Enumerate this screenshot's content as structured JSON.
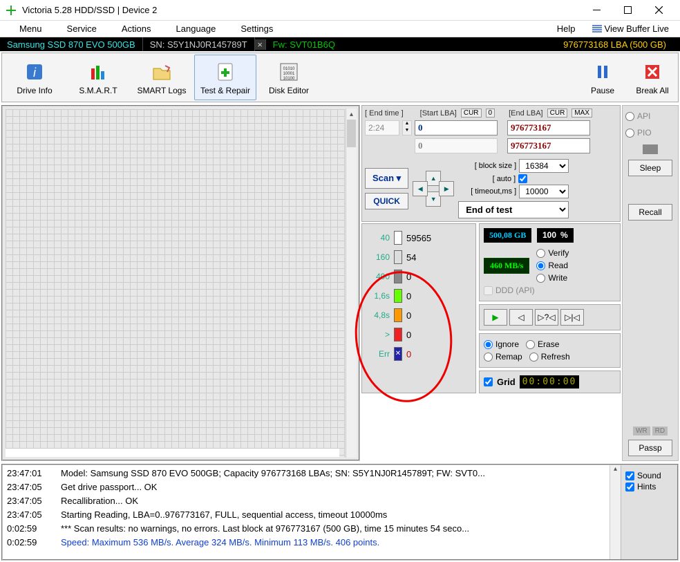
{
  "window": {
    "title": "Victoria 5.28 HDD/SSD | Device 2"
  },
  "menu": {
    "items": [
      "Menu",
      "Service",
      "Actions",
      "Language",
      "Settings"
    ],
    "help": "Help",
    "viewbuffer": "View Buffer Live"
  },
  "infostrip": {
    "drive": "Samsung SSD 870 EVO 500GB",
    "sn": "SN: S5Y1NJ0R145789T",
    "fw": "Fw: SVT01B6Q",
    "lba": "976773168 LBA (500 GB)"
  },
  "toolbar": {
    "driveinfo": "Drive Info",
    "smart": "S.M.A.R.T",
    "smartlogs": "SMART Logs",
    "testrepair": "Test & Repair",
    "diskeditor": "Disk Editor",
    "pause": "Pause",
    "breakall": "Break All"
  },
  "scan": {
    "endtime_lbl": "[ End time ]",
    "startlba_lbl": "[Start LBA]",
    "endlba_lbl": "[End LBA]",
    "cur": "CUR",
    "max": "MAX",
    "zero": "0",
    "endtime_val": "2:24",
    "start_lba": "0",
    "end_lba": "976773167",
    "start_lba_ro": "0",
    "end_lba_ro": "976773167",
    "scan_btn": "Scan ▾",
    "quick_btn": "QUICK",
    "blocksize_lbl": "[ block size ]",
    "auto_lbl": "[ auto ]",
    "timeout_lbl": "[ timeout,ms ]",
    "blocksize": "16384",
    "timeout": "10000",
    "eot": "End of test"
  },
  "stats": [
    {
      "lbl": "40",
      "cls": "b-white",
      "cnt": "59565"
    },
    {
      "lbl": "160",
      "cls": "b-lgray",
      "cnt": "54"
    },
    {
      "lbl": "400",
      "cls": "b-dgray",
      "cnt": "0"
    },
    {
      "lbl": "1,6s",
      "cls": "b-green",
      "cnt": "0"
    },
    {
      "lbl": "4,8s",
      "cls": "b-orange",
      "cnt": "0"
    },
    {
      "lbl": ">",
      "cls": "b-red",
      "cnt": "0"
    },
    {
      "lbl": "Err",
      "cls": "b-blue errx",
      "cnt": "0",
      "err": true
    }
  ],
  "status": {
    "size": "500,08 GB",
    "pct": "100",
    "pct_sym": "%",
    "speed": "460 MB/s",
    "verify": "Verify",
    "read": "Read",
    "write": "Write",
    "ddd": "DDD (API)",
    "ignore": "Ignore",
    "erase": "Erase",
    "remap": "Remap",
    "refresh": "Refresh",
    "grid": "Grid",
    "grid_time": "00:00:00"
  },
  "side": {
    "api": "API",
    "pio": "PIO",
    "sleep": "Sleep",
    "recall": "Recall",
    "passp": "Passp",
    "wr": "WR",
    "rd": "RD"
  },
  "log": {
    "lines": [
      {
        "ts": "23:47:01",
        "msg": "Model: Samsung SSD 870 EVO 500GB; Capacity 976773168 LBAs; SN: S5Y1NJ0R145789T; FW: SVT0..."
      },
      {
        "ts": "23:47:05",
        "msg": "Get drive passport... OK"
      },
      {
        "ts": "23:47:05",
        "msg": "Recallibration... OK"
      },
      {
        "ts": "23:47:05",
        "msg": "Starting Reading, LBA=0..976773167, FULL, sequential access, timeout 10000ms"
      },
      {
        "ts": "0:02:59",
        "msg": "*** Scan results: no warnings, no errors. Last block at 976773167 (500 GB), time 15 minutes 54 seco..."
      },
      {
        "ts": "0:02:59",
        "msg": "Speed: Maximum 536 MB/s. Average 324 MB/s. Minimum 113 MB/s. 406 points.",
        "cls": "blue"
      }
    ],
    "sound": "Sound",
    "hints": "Hints"
  }
}
